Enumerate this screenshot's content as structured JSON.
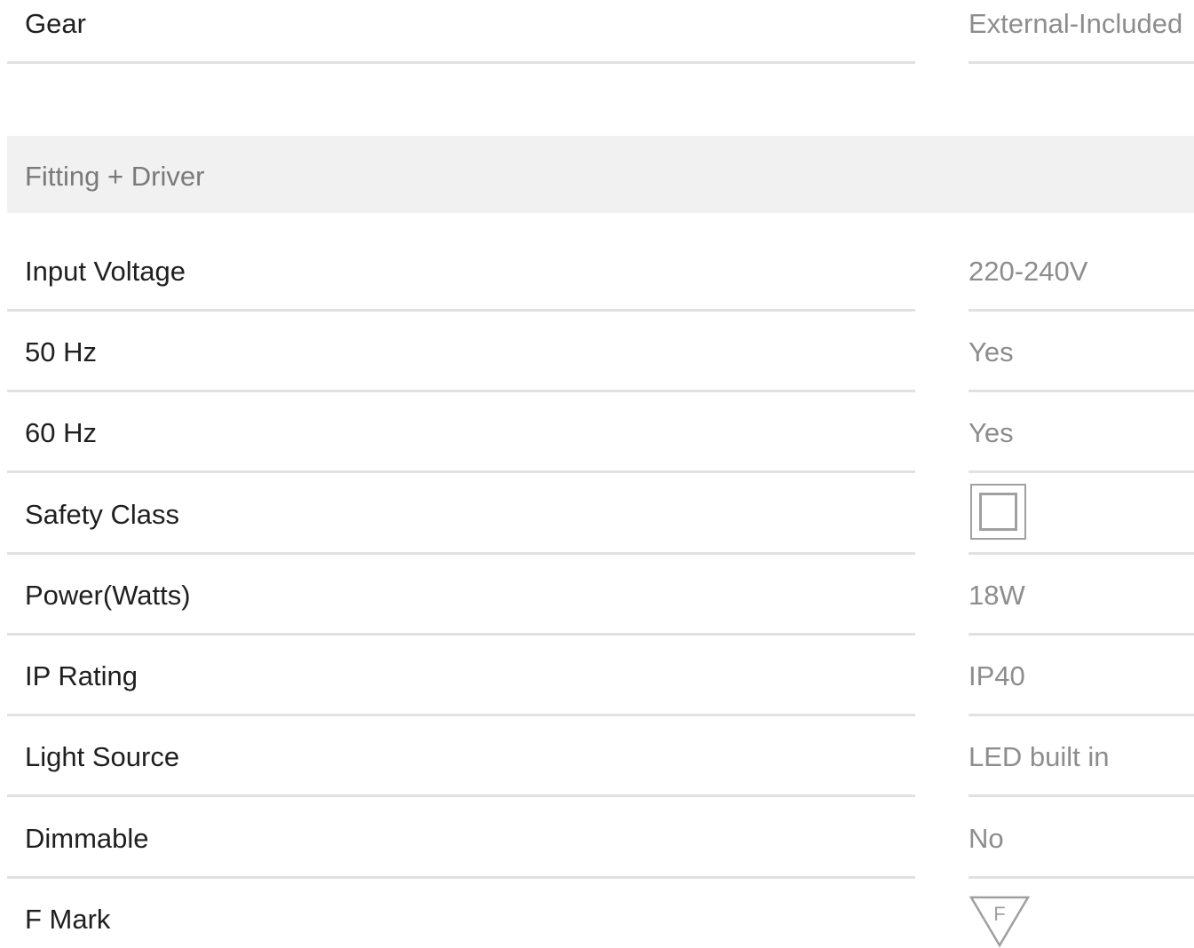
{
  "rows_top": [
    {
      "label": "Gear",
      "value": "External-Included"
    }
  ],
  "section": {
    "title": "Fitting + Driver"
  },
  "rows": [
    {
      "label": "Input Voltage",
      "value": "220-240V"
    },
    {
      "label": "50 Hz",
      "value": "Yes"
    },
    {
      "label": "60 Hz",
      "value": "Yes"
    },
    {
      "label": "Safety Class",
      "icon": "double-square-class-ii-icon"
    },
    {
      "label": "Power(Watts)",
      "value": "18W"
    },
    {
      "label": "IP Rating",
      "value": "IP40"
    },
    {
      "label": "Light Source",
      "value": "LED built in"
    },
    {
      "label": "Dimmable",
      "value": "No"
    },
    {
      "label": "F Mark",
      "icon": "f-mark-triangle-icon",
      "icon_text": "F"
    }
  ],
  "colors": {
    "label": "#1f1f1f",
    "value": "#8d8d8d",
    "divider": "#e1e1e1",
    "section_bg": "#f1f1f1",
    "section_text": "#7a7a7a",
    "icon_stroke": "#a0a0a0"
  }
}
